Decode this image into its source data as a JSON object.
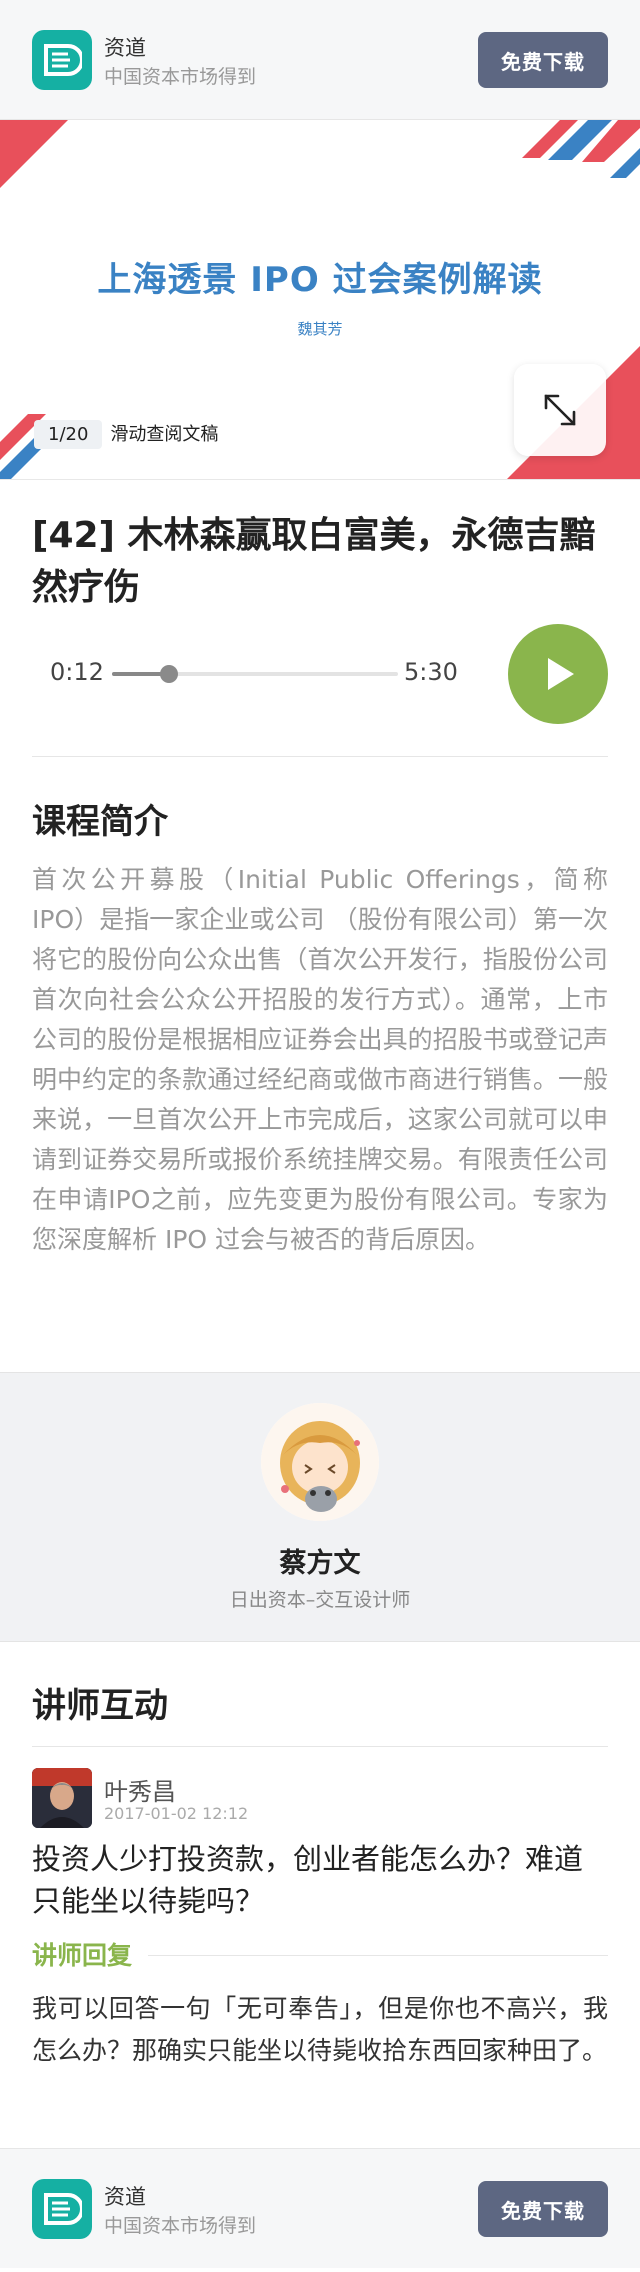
{
  "app_banner": {
    "name": "资道",
    "tagline": "中国资本市场得到",
    "download_label": "免费下载",
    "logo_icon": "zidao-logo-icon",
    "brand_color": "#15b0a3",
    "button_color": "#5d6782"
  },
  "slide": {
    "title": "上海透景 IPO 过会案例解读",
    "author": "魏其芳",
    "page": "1/20",
    "hint": "滑动查阅文稿",
    "expand_icon": "expand-arrows-icon",
    "accent_blue": "#3a82c4",
    "accent_red": "#e8505b"
  },
  "lesson": {
    "title": "[42] 木林森赢取白富美，永德吉黯然疗伤",
    "current_time": "0:12",
    "total_time": "5:30",
    "progress": 0.2,
    "play_icon": "play-icon",
    "play_color": "#8ab54c"
  },
  "intro": {
    "heading": "课程简介",
    "text": "首次公开募股（Initial Public Offerings，简称IPO）是指一家企业或公司 （股份有限公司）第一次将它的股份向公众出售（首次公开发行，指股份公司首次向社会公众公开招股的发行方式）。通常，上市公司的股份是根据相应证券会出具的招股书或登记声明中约定的条款通过经纪商或做市商进行销售。一般来说，一旦首次公开上市完成后，这家公司就可以申请到证券交易所或报价系统挂牌交易。有限责任公司在申请IPO之前，应先变更为股份有限公司。专家为您深度解析 IPO 过会与被否的背后原因。"
  },
  "lecturer": {
    "name": "蔡方文",
    "title": "日出资本–交互设计师"
  },
  "interaction": {
    "heading": "讲师互动",
    "user_name": "叶秀昌",
    "time": "2017-01-02 12:12",
    "question": "投资人少打投资款，创业者能怎么办？难道只能坐以待毙吗？",
    "reply_label": "讲师回复",
    "reply": "我可以回答一句「无可奉告」，但是你也不高兴，我怎么办？那确实只能坐以待毙收拾东西回家种田了。"
  }
}
